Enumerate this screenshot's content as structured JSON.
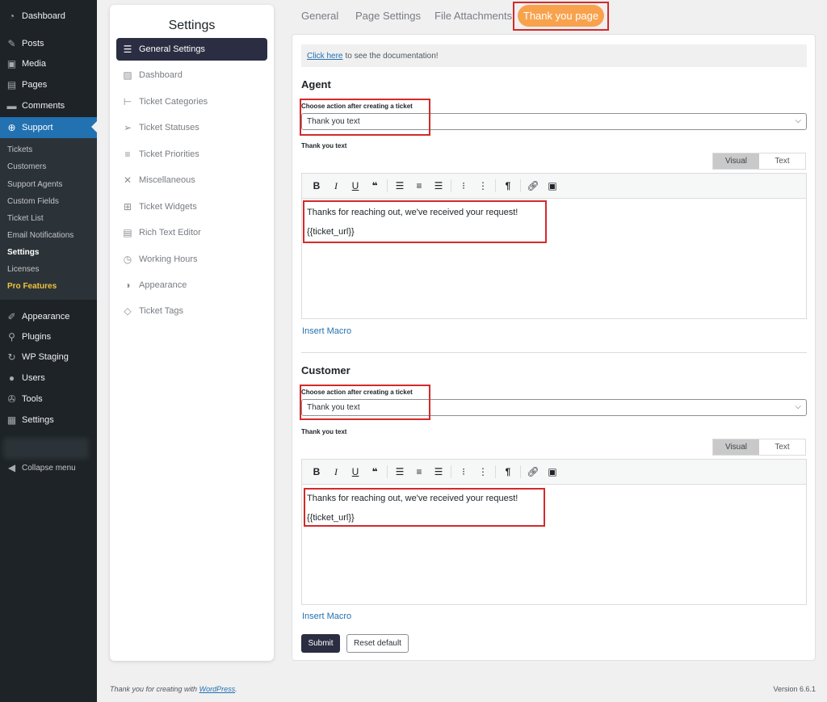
{
  "admin_menu": {
    "top_items": [
      {
        "label": "Dashboard",
        "icon": "dashboard-icon"
      },
      {
        "label": "Posts",
        "icon": "pin-icon"
      },
      {
        "label": "Media",
        "icon": "media-icon"
      },
      {
        "label": "Pages",
        "icon": "pages-icon"
      },
      {
        "label": "Comments",
        "icon": "comments-icon"
      },
      {
        "label": "Support",
        "icon": "support-icon"
      }
    ],
    "sub_items": [
      "Tickets",
      "Customers",
      "Support Agents",
      "Custom Fields",
      "Ticket List",
      "Email Notifications",
      "Settings",
      "Licenses",
      "Pro Features"
    ],
    "bottom_items": [
      {
        "label": "Appearance",
        "icon": "brush-icon"
      },
      {
        "label": "Plugins",
        "icon": "plugin-icon"
      },
      {
        "label": "WP Staging",
        "icon": "sync-icon"
      },
      {
        "label": "Users",
        "icon": "users-icon"
      },
      {
        "label": "Tools",
        "icon": "wrench-icon"
      },
      {
        "label": "Settings",
        "icon": "settings-icon"
      }
    ],
    "collapse_label": "Collapse menu"
  },
  "settings_nav": {
    "title": "Settings",
    "items": [
      {
        "label": "General Settings"
      },
      {
        "label": "Dashboard"
      },
      {
        "label": "Ticket Categories"
      },
      {
        "label": "Ticket Statuses"
      },
      {
        "label": "Ticket Priorities"
      },
      {
        "label": "Miscellaneous"
      },
      {
        "label": "Ticket Widgets"
      },
      {
        "label": "Rich Text Editor"
      },
      {
        "label": "Working Hours"
      },
      {
        "label": "Appearance"
      },
      {
        "label": "Ticket Tags"
      }
    ]
  },
  "tabs": [
    "General",
    "Page Settings",
    "File Attachments",
    "Thank you page"
  ],
  "doc": {
    "link": "Click here",
    "text": "to see the documentation!"
  },
  "agent": {
    "heading": "Agent",
    "action_label": "Choose action after creating a ticket",
    "action_value": "Thank you text",
    "text_label": "Thank you text",
    "visual_tab": "Visual",
    "text_tab": "Text",
    "line1": "Thanks for reaching out, we've received your request!",
    "line2": "{{ticket_url}}",
    "macro": "Insert Macro"
  },
  "customer": {
    "heading": "Customer",
    "action_label": "Choose action after creating a ticket",
    "action_value": "Thank you text",
    "text_label": "Thank you text",
    "visual_tab": "Visual",
    "text_tab": "Text",
    "line1": "Thanks for reaching out, we've received your request!",
    "line2": "{{ticket_url}}",
    "macro": "Insert Macro"
  },
  "buttons": {
    "submit": "Submit",
    "reset": "Reset default"
  },
  "footer": {
    "prefix": "Thank you for creating with",
    "link": "WordPress",
    "suffix": ".",
    "version": "Version 6.6.1"
  },
  "colors": {
    "accent": "#f9a24d",
    "highlight": "#d42a2a",
    "active_nav": "#2b2d42",
    "wp_blue": "#2271b1"
  }
}
